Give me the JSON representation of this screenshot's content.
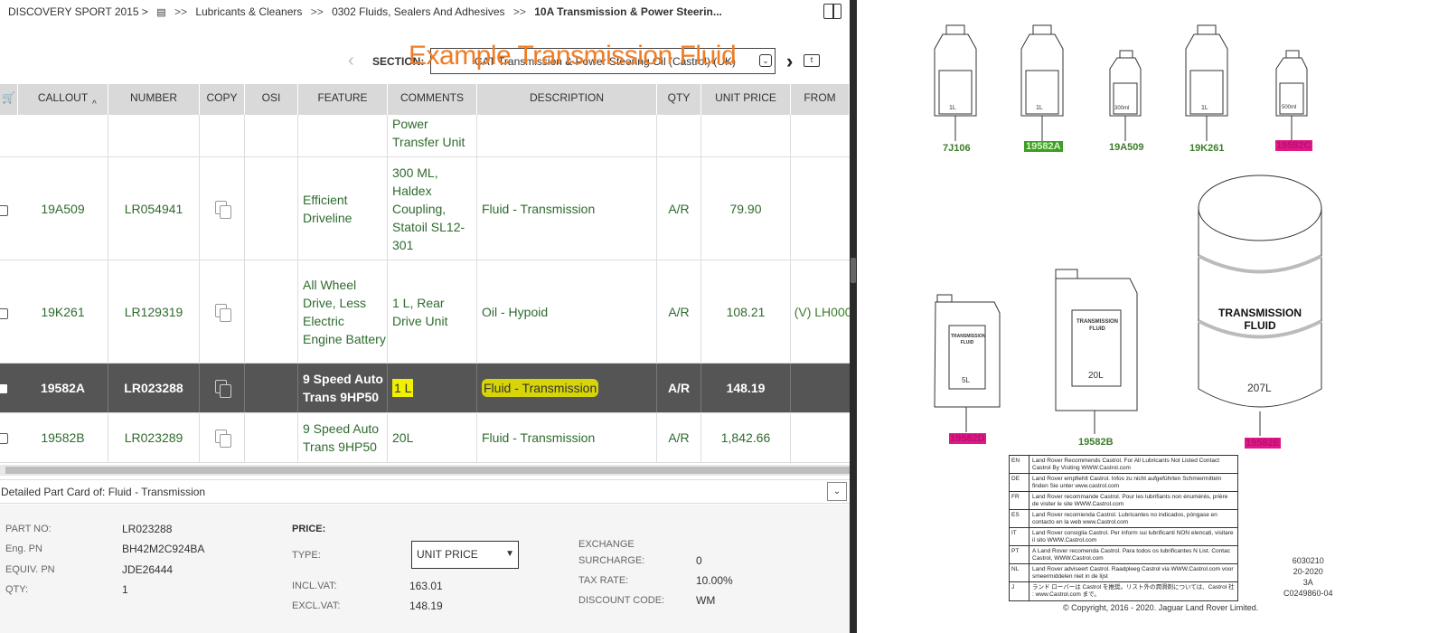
{
  "breadcrumb": {
    "model": "DISCOVERY SPORT 2015 >",
    "sep1": ">>",
    "group": "Lubricants & Cleaners",
    "sep2": ">>",
    "subgroup": "0302 Fluids, Sealers And Adhesives",
    "sep3": ">>",
    "current": "10A Transmission & Power Steerin..."
  },
  "section": {
    "label": "SECTION:",
    "value": "CAT Transmission & Power Steering Oil (Castrol) (UK)",
    "overlay": "Example Transmission Fluid",
    "prev": "‹",
    "next": "›"
  },
  "table": {
    "headers": [
      "",
      "CALLOUT",
      "NUMBER",
      "COPY",
      "OSI",
      "FEATURE",
      "COMMENTS",
      "DESCRIPTION",
      "QTY",
      "UNIT PRICE",
      "FROM"
    ],
    "rows": [
      {
        "callout": "",
        "number": "",
        "feature": "",
        "comments": "Power Transfer Unit",
        "description": "",
        "qty": "",
        "price": "",
        "from": ""
      },
      {
        "callout": "19A509",
        "number": "LR054941",
        "feature": "Efficient Driveline",
        "comments": "300 ML, Haldex Coupling, Statoil SL12-301",
        "description": "Fluid - Transmission",
        "qty": "A/R",
        "price": "79.90",
        "from": ""
      },
      {
        "callout": "19K261",
        "number": "LR129319",
        "feature": "All Wheel Drive, Less Electric Engine Battery",
        "comments": "1 L, Rear Drive Unit",
        "description": "Oil - Hypoid",
        "qty": "A/R",
        "price": "108.21",
        "from": "(V) LH0000"
      },
      {
        "callout": "19582A",
        "number": "LR023288",
        "feature": "9 Speed Auto Trans 9HP50",
        "comments": "1 L",
        "description": "Fluid - Transmission",
        "qty": "A/R",
        "price": "148.19",
        "from": ""
      },
      {
        "callout": "19582B",
        "number": "LR023289",
        "feature": "9 Speed Auto Trans 9HP50",
        "comments": "20L",
        "description": "Fluid - Transmission",
        "qty": "A/R",
        "price": "1,842.66",
        "from": ""
      }
    ]
  },
  "card": {
    "title": "Detailed Part Card of:  Fluid - Transmission",
    "part_no_label": "PART NO:",
    "part_no": "LR023288",
    "eng_pn_label": "Eng. PN",
    "eng_pn": "BH42M2C924BA",
    "equiv_pn_label": "EQUIV. PN",
    "equiv_pn": "JDE26444",
    "qty_label": "QTY:",
    "qty": "1",
    "price_label": "PRICE:",
    "type_label": "TYPE:",
    "type_value": "UNIT PRICE",
    "incl_vat_label": "INCL.VAT:",
    "incl_vat": "163.01",
    "excl_vat_label": "EXCL.VAT:",
    "excl_vat": "148.19",
    "exchange_label": "EXCHANGE",
    "surcharge_label": "SURCHARGE:",
    "surcharge": "0",
    "tax_rate_label": "TAX RATE:",
    "tax_rate": "10.00%",
    "discount_label": "DISCOUNT CODE:",
    "discount": "WM"
  },
  "diagram": {
    "callouts": [
      "7J106",
      "19582A",
      "19A509",
      "19K261",
      "19582C",
      "19582D",
      "19582B",
      "19582E"
    ],
    "bottle_labels": [
      "1L",
      "1L",
      "300ml",
      "1L",
      "500ml"
    ],
    "can_labels": [
      "TRANSMISSION FLUID",
      "5L",
      "TRANSMISSION FLUID",
      "20L"
    ],
    "drum_label": "TRANSMISSION FLUID",
    "drum_volume": "207L",
    "languages": [
      {
        "code": "EN",
        "text": "Land Rover Recommends Castrol.  For All Lubricants Not Listed Contact Castrol By Visiting WWW.Castrol.com"
      },
      {
        "code": "DE",
        "text": "Land Rover empfiehlt Castrol.  Infos zu nicht aufgeführten Schmiermitteln finden Sie unter www.castrol.com"
      },
      {
        "code": "FR",
        "text": "Land Rover recommande Castrol. Pour les lubrifiants non énumérés, prière de visiter le site WWW.Castrol.com"
      },
      {
        "code": "ES",
        "text": "Land Rover recomienda Castrol.  Lubricantes no indicados, póngase en contacto en la web www.Castrol.com"
      },
      {
        "code": "IT",
        "text": "Land Rover consiglia Castrol.  Per inform sui lubrificanti NON elencati, visitare il sito WWW.Castrol.com"
      },
      {
        "code": "PT",
        "text": "A Land Rover recomenda Castrol.  Para todos os lubrificantes N List. Contac Castrol, WWW.Castrol.com"
      },
      {
        "code": "NL",
        "text": "Land Rover adviseert Castrol.  Raadpleeg Castrol via WWW.Castrol.com voor smeermiddelen niet in de lijst"
      },
      {
        "code": "J",
        "text": "ランド ローバーは Castrol を推奨。リスト外の潤滑剤については、Castrol 社 : www.Castrol.com まで。"
      }
    ],
    "ref_lines": [
      "6030210",
      "20-2020",
      "3A",
      "C0249860-04"
    ],
    "copyright": "© Copyright, 2016 - 2020. Jaguar Land Rover Limited."
  }
}
